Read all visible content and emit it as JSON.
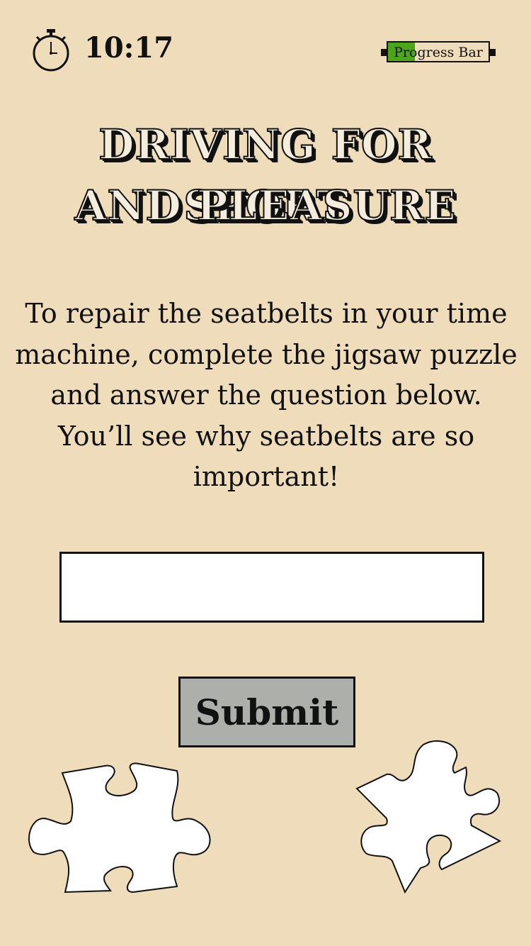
{
  "status": {
    "timer_icon": "stopwatch-icon",
    "time": "10:17",
    "progress_label": "Progress Bar",
    "progress_fraction": 0.27,
    "progress_color": "#4ea51b"
  },
  "title": {
    "line1": "DRIVING FOR SPORT",
    "line2": "AND PLEASURE"
  },
  "instructions": "To repair the seatbelts in your time machine, complete the jigsaw puzzle and answer the question below. You’ll see why seatbelts are so important!",
  "answer_input": {
    "value": "",
    "placeholder": ""
  },
  "submit_label": "Submit",
  "pieces": [
    "jigsaw-piece-icon",
    "jigsaw-piece-icon"
  ],
  "colors": {
    "background": "#eedcbb",
    "button": "#adb0aa"
  }
}
